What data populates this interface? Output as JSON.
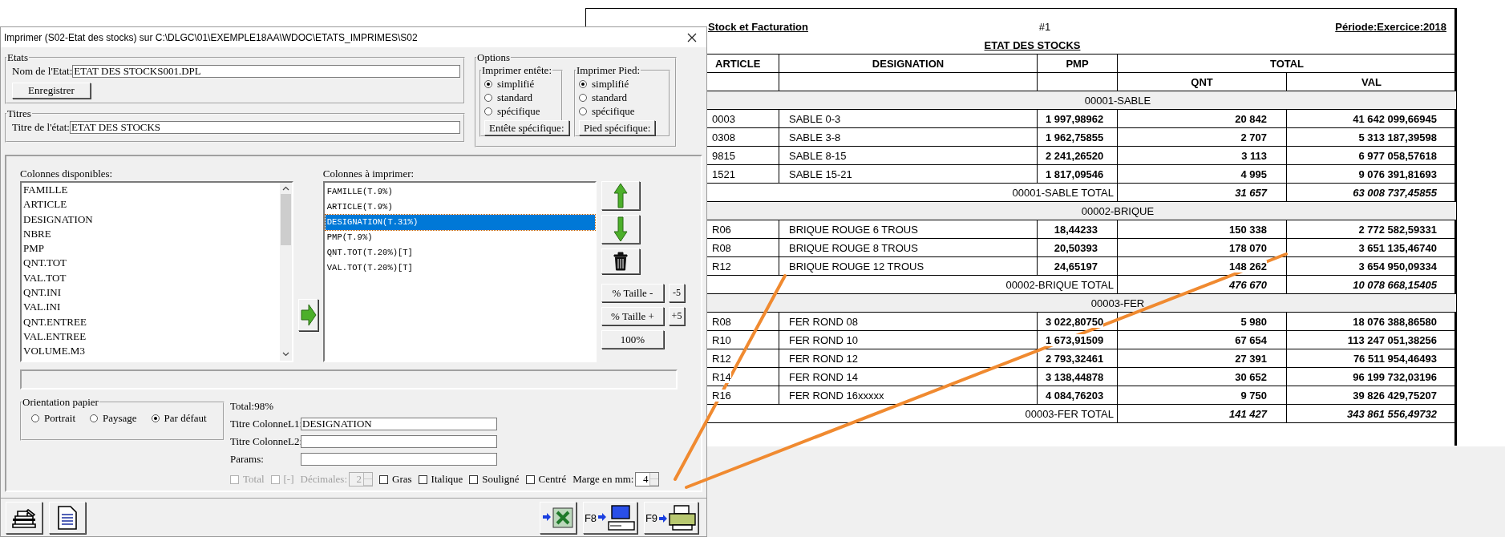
{
  "dialog": {
    "title": "Imprimer (S02-Etat des stocks)  sur C:\\DLGC\\01\\EXEMPLE18AA\\WDOC\\ETATS_IMPRIMES\\S02",
    "etats": {
      "legend": "Etats",
      "name_label": "Nom de l'Etat:",
      "name_value": "ETAT DES STOCKS001.DPL",
      "save_button": "Enregistrer"
    },
    "titres": {
      "legend": "Titres",
      "title_label": "Titre de l'état:",
      "title_value": "ETAT DES STOCKS"
    },
    "options": {
      "legend": "Options",
      "groups": [
        {
          "legend": "Imprimer entête:",
          "choices": [
            {
              "label": "simplifié",
              "selected": true
            },
            {
              "label": "standard",
              "selected": false
            },
            {
              "label": "spécifique",
              "selected": false
            }
          ],
          "button": "Entête spécifique:"
        },
        {
          "legend": "Imprimer Pied:",
          "choices": [
            {
              "label": "simplifié",
              "selected": true
            },
            {
              "label": "standard",
              "selected": false
            },
            {
              "label": "spécifique",
              "selected": false
            }
          ],
          "button": "Pied spécifique:"
        }
      ]
    },
    "available_columns": {
      "label": "Colonnes disponibles:",
      "items": [
        "FAMILLE",
        "ARTICLE",
        "DESIGNATION",
        "NBRE",
        "PMP",
        "QNT.TOT",
        "VAL.TOT",
        "QNT.INI",
        "VAL.INI",
        "QNT.ENTREE",
        "VAL.ENTREE",
        "VOLUME.M3"
      ]
    },
    "print_columns": {
      "label": "Colonnes à imprimer:",
      "items": [
        {
          "label": "FAMILLE(T.9%)",
          "selected": false
        },
        {
          "label": "ARTICLE(T.9%)",
          "selected": false
        },
        {
          "label": "DESIGNATION(T.31%)",
          "selected": true
        },
        {
          "label": "PMP(T.9%)",
          "selected": false
        },
        {
          "label": "QNT.TOT(T.20%)[T]",
          "selected": false
        },
        {
          "label": "VAL.TOT(T.20%)[T]",
          "selected": false
        }
      ]
    },
    "size_buttons": [
      {
        "label": "% Taille -",
        "step": "-5"
      },
      {
        "label": "% Taille +",
        "step": "+5"
      }
    ],
    "reset_button": "100%",
    "orientation": {
      "legend": "Orientation papier",
      "choices": [
        {
          "label": "Portrait",
          "selected": false
        },
        {
          "label": "Paysage",
          "selected": false
        },
        {
          "label": "Par défaut",
          "selected": true
        }
      ]
    },
    "total": "Total:98%",
    "fields": [
      {
        "label": "Titre ColonneL1:",
        "value": "DESIGNATION"
      },
      {
        "label": "Titre ColonneL2:"
      },
      {
        "label": "Params:"
      }
    ],
    "format_options": [
      {
        "kind": "checkbox",
        "label": "Total",
        "checked": false,
        "disabled": true
      },
      {
        "kind": "checkbox",
        "label": "[-]",
        "checked": false,
        "disabled": true
      },
      {
        "kind": "spinner",
        "label": "Décimales:",
        "value": "2",
        "disabled": true
      },
      {
        "kind": "checkbox",
        "label": "Gras",
        "checked": false,
        "disabled": false
      },
      {
        "kind": "checkbox",
        "label": "Italique",
        "checked": false,
        "disabled": false
      },
      {
        "kind": "checkbox",
        "label": "Souligné",
        "checked": false,
        "disabled": false
      },
      {
        "kind": "checkbox",
        "label": "Centré",
        "checked": false,
        "disabled": false
      },
      {
        "kind": "spinner",
        "label": "Marge en mm:",
        "value": "4",
        "disabled": false
      }
    ],
    "preview_key": "F8",
    "print_key": "F9"
  },
  "report": {
    "header_left": "Stock et Facturation",
    "page_number": "#1",
    "period": "Période:Exercice:2018",
    "title": "ETAT DES STOCKS",
    "columns": {
      "article": "ARTICLE",
      "designation": "DESIGNATION",
      "pmp": "PMP",
      "total": "TOTAL",
      "qnt": "QNT",
      "val": "VAL"
    },
    "groups": [
      {
        "name": "00001-SABLE",
        "rows": [
          {
            "article": "0003",
            "designation": "SABLE 0-3",
            "pmp": "1 997,98962",
            "qnt": "20 842",
            "val": "41 642 099,66945"
          },
          {
            "article": "0308",
            "designation": "SABLE 3-8",
            "pmp": "1 962,75855",
            "qnt": "2 707",
            "val": "5 313 187,39598"
          },
          {
            "article": "9815",
            "designation": "SABLE 8-15",
            "pmp": "2 241,26520",
            "qnt": "3 113",
            "val": "6 977 058,57618"
          },
          {
            "article": "1521",
            "designation": "SABLE 15-21",
            "pmp": "1 817,09546",
            "qnt": "4 995",
            "val": "9 076 391,81693"
          }
        ],
        "total_label": "00001-SABLE  TOTAL",
        "total_qnt": "31 657",
        "total_val": "63 008 737,45855"
      },
      {
        "name": "00002-BRIQUE",
        "rows": [
          {
            "article": "R06",
            "designation": "BRIQUE ROUGE 6 TROUS",
            "pmp": "18,44233",
            "qnt": "150 338",
            "val": "2 772 582,59331"
          },
          {
            "article": "R08",
            "designation": "BRIQUE ROUGE 8 TROUS",
            "pmp": "20,50393",
            "qnt": "178 070",
            "val": "3 651 135,46740"
          },
          {
            "article": "R12",
            "designation": "BRIQUE ROUGE 12 TROUS",
            "pmp": "24,65197",
            "qnt": "148 262",
            "val": "3 654 950,09334"
          }
        ],
        "total_label": "00002-BRIQUE  TOTAL",
        "total_qnt": "476 670",
        "total_val": "10 078 668,15405"
      },
      {
        "name": "00003-FER",
        "rows": [
          {
            "article": "R08",
            "designation": "FER ROND 08",
            "pmp": "3 022,80750",
            "qnt": "5 980",
            "val": "18 076 388,86580"
          },
          {
            "article": "R10",
            "designation": "FER ROND 10",
            "pmp": "1 673,91509",
            "qnt": "67 654",
            "val": "113 247 051,38256"
          },
          {
            "article": "R12",
            "designation": "FER ROND 12",
            "pmp": "2 793,32461",
            "qnt": "27 391",
            "val": "76 511 954,46493"
          },
          {
            "article": "R14",
            "designation": "FER ROND 14",
            "pmp": "3 138,44878",
            "qnt": "30 652",
            "val": "96 199 732,03196"
          },
          {
            "article": "R16",
            "designation": "FER ROND 16xxxxx",
            "pmp": "4 084,76203",
            "qnt": "9 750",
            "val": "39 826 429,75207"
          }
        ],
        "total_label": "00003-FER  TOTAL",
        "total_qnt": "141 427",
        "total_val": "343 861 556,49732"
      }
    ]
  }
}
